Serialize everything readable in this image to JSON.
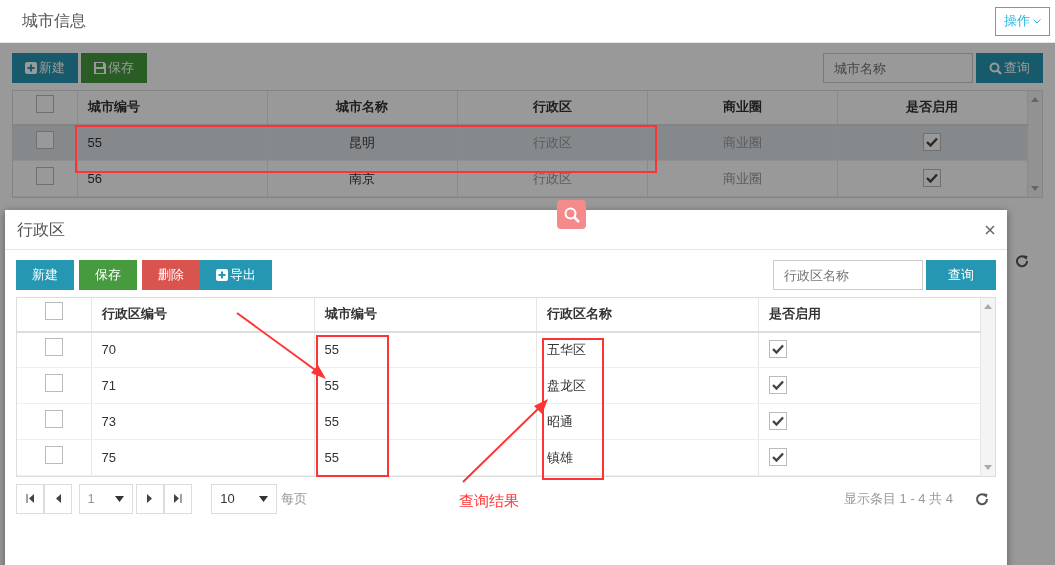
{
  "page": {
    "title": "城市信息",
    "action_button": "操作",
    "buttons": [
      {
        "label": "新建",
        "kind": "new"
      },
      {
        "label": "保存",
        "kind": "save"
      }
    ],
    "search": {
      "placeholder": "城市名称",
      "button": "查询"
    },
    "table": {
      "all_checked": false,
      "columns": [
        "城市编号",
        "城市名称",
        "行政区",
        "商业圈",
        "是否启用"
      ],
      "rows": [
        {
          "selected": true,
          "checked": false,
          "cells": [
            "55",
            "昆明",
            "行政区",
            "商业圈"
          ],
          "enabled": true
        },
        {
          "selected": false,
          "checked": false,
          "cells": [
            "56",
            "南京",
            "行政区",
            "商业圈"
          ],
          "enabled": true
        }
      ]
    }
  },
  "modal": {
    "title": "行政区",
    "buttons": [
      {
        "label": "新建",
        "kind": "new"
      },
      {
        "label": "保存",
        "kind": "save"
      },
      {
        "label": "删除",
        "kind": "delete"
      },
      {
        "label": "导出",
        "kind": "export"
      }
    ],
    "search": {
      "placeholder": "行政区名称",
      "button": "查询"
    },
    "table": {
      "all_checked": false,
      "columns": [
        "行政区编号",
        "城市编号",
        "行政区名称",
        "是否启用"
      ],
      "rows": [
        {
          "checked": false,
          "cells": [
            "70",
            "55",
            "五华区"
          ],
          "enabled": true
        },
        {
          "checked": false,
          "cells": [
            "71",
            "55",
            "盘龙区"
          ],
          "enabled": true
        },
        {
          "checked": false,
          "cells": [
            "73",
            "55",
            "昭通"
          ],
          "enabled": true
        },
        {
          "checked": false,
          "cells": [
            "75",
            "55",
            "镇雄"
          ],
          "enabled": true
        }
      ]
    },
    "pager": {
      "page": "1",
      "page_size": "10",
      "per_page_label": "每页",
      "summary": "显示条目 1 - 4 共 4"
    }
  },
  "annotation": {
    "label": "查询结果"
  }
}
